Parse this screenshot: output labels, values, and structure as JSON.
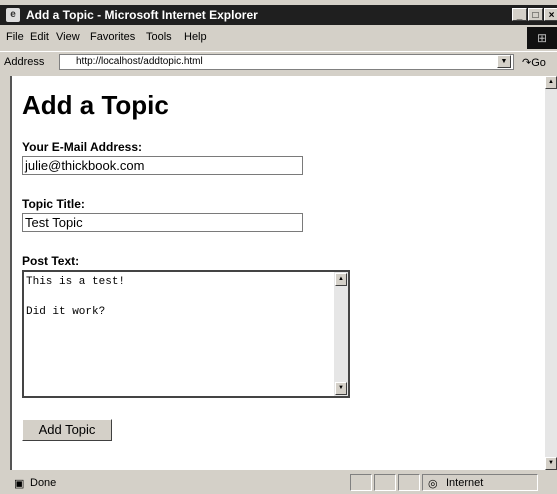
{
  "window": {
    "title": "Add a Topic - Microsoft Internet Explorer",
    "app_icon": "ie-icon",
    "controls": [
      "_",
      "□",
      "×"
    ]
  },
  "menu": {
    "items": [
      {
        "label": "File"
      },
      {
        "label": "Edit"
      },
      {
        "label": "View"
      },
      {
        "label": "Favorites"
      },
      {
        "label": "Tools"
      },
      {
        "label": "Help"
      }
    ]
  },
  "address": {
    "label": "Address",
    "url": "http://localhost/addtopic.html",
    "go_label": "Go"
  },
  "page": {
    "heading": "Add a Topic",
    "email_label": "Your E-Mail Address:",
    "email_value": "julie@thickbook.com",
    "title_label": "Topic Title:",
    "title_value": "Test Topic",
    "post_label": "Post Text:",
    "post_value": "This is a test!\n\nDid it work?",
    "submit_label": "Add Topic"
  },
  "status": {
    "text": "Done",
    "zone": "Internet"
  }
}
